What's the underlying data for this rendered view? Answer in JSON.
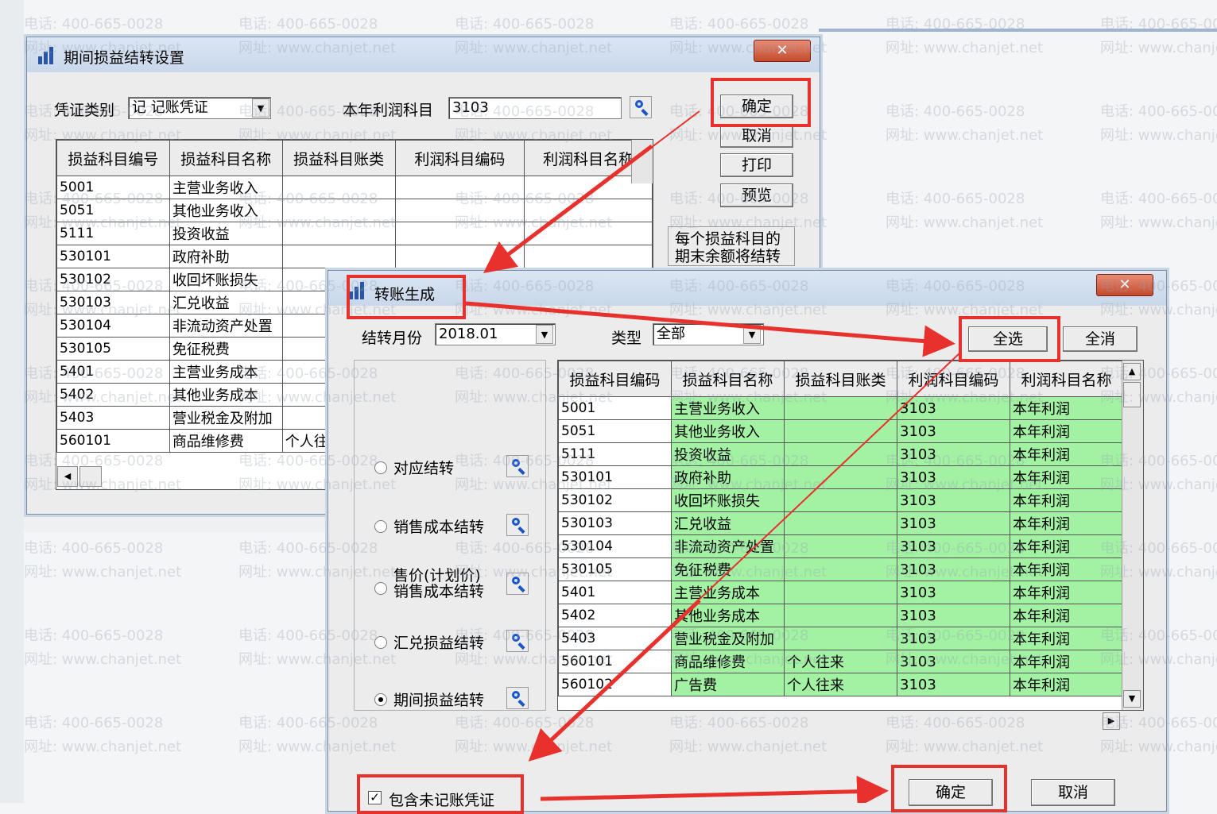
{
  "dialog1": {
    "title": "期间损益结转设置",
    "voucher_type_label": "凭证类别",
    "voucher_type_value": "记  记账凭证",
    "profit_account_label": "本年利润科目",
    "profit_account_value": "3103",
    "buttons": {
      "ok": "确定",
      "cancel": "取消",
      "print": "打印",
      "preview": "预览"
    },
    "note_line1": "每个损益科目的",
    "note_line2": "期末余额将结转",
    "columns": [
      "损益科目编号",
      "损益科目名称",
      "损益科目账类",
      "利润科目编码",
      "利润科目名称"
    ],
    "rows": [
      [
        "5001",
        "主营业务收入",
        ""
      ],
      [
        "5051",
        "其他业务收入",
        ""
      ],
      [
        "5111",
        "投资收益",
        ""
      ],
      [
        "530101",
        "政府补助",
        ""
      ],
      [
        "530102",
        "收回坏账损失",
        ""
      ],
      [
        "530103",
        "汇兑收益",
        ""
      ],
      [
        "530104",
        "非流动资产处置",
        ""
      ],
      [
        "530105",
        "免征税费",
        ""
      ],
      [
        "5401",
        "主营业务成本",
        ""
      ],
      [
        "5402",
        "其他业务成本",
        ""
      ],
      [
        "5403",
        "营业税金及附加",
        ""
      ],
      [
        "560101",
        "商品维修费",
        "个人往来"
      ]
    ]
  },
  "dialog2": {
    "title": "转账生成",
    "month_label": "结转月份",
    "month_value": "2018.01",
    "type_label": "类型",
    "type_value": "全部",
    "select_all": "全选",
    "deselect_all": "全消",
    "radios": [
      {
        "label": "对应结转",
        "checked": false
      },
      {
        "label": "销售成本结转",
        "checked": false
      },
      {
        "label": "售价(计划价)",
        "label2": "销售成本结转",
        "checked": false
      },
      {
        "label": "汇兑损益结转",
        "checked": false
      },
      {
        "label": "期间损益结转",
        "checked": true
      }
    ],
    "columns": [
      "损益科目编码",
      "损益科目名称",
      "损益科目账类",
      "利润科目编码",
      "利润科目名称"
    ],
    "rows": [
      [
        "5001",
        "主营业务收入",
        "",
        "3103",
        "本年利润"
      ],
      [
        "5051",
        "其他业务收入",
        "",
        "3103",
        "本年利润"
      ],
      [
        "5111",
        "投资收益",
        "",
        "3103",
        "本年利润"
      ],
      [
        "530101",
        "政府补助",
        "",
        "3103",
        "本年利润"
      ],
      [
        "530102",
        "收回坏账损失",
        "",
        "3103",
        "本年利润"
      ],
      [
        "530103",
        "汇兑收益",
        "",
        "3103",
        "本年利润"
      ],
      [
        "530104",
        "非流动资产处置",
        "",
        "3103",
        "本年利润"
      ],
      [
        "530105",
        "免征税费",
        "",
        "3103",
        "本年利润"
      ],
      [
        "5401",
        "主营业务成本",
        "",
        "3103",
        "本年利润"
      ],
      [
        "5402",
        "其他业务成本",
        "",
        "3103",
        "本年利润"
      ],
      [
        "5403",
        "营业税金及附加",
        "",
        "3103",
        "本年利润"
      ],
      [
        "560101",
        "商品维修费",
        "个人往来",
        "3103",
        "本年利润"
      ],
      [
        "560102",
        "广告费",
        "个人往来",
        "3103",
        "本年利润"
      ]
    ],
    "include_unposted": "包含未记账凭证",
    "ok": "确定",
    "cancel": "取消"
  },
  "watermark": {
    "phone": "电话: 400-665-0028",
    "site": "网址: www.chanjet.net"
  }
}
